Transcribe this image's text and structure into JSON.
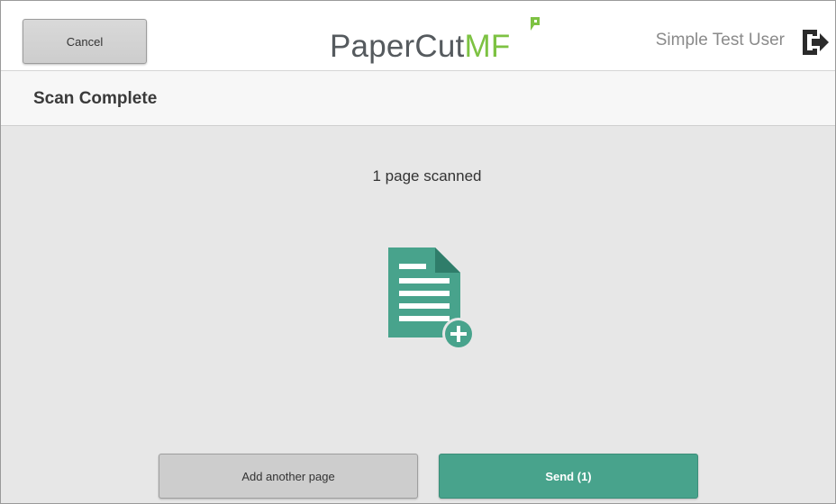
{
  "header": {
    "cancel_label": "Cancel",
    "logo": {
      "part1": "PaperCut",
      "part2": "MF"
    },
    "user_name": "Simple Test User",
    "logout_icon": "logout-icon"
  },
  "title_bar": {
    "title": "Scan Complete"
  },
  "main": {
    "status": "1 page scanned",
    "document_icon": "document-add-icon",
    "add_page_label": "Add another page",
    "send_label": "Send (1)"
  },
  "colors": {
    "accent": "#48a38c",
    "logo_green": "#7dc242",
    "logo_gray": "#555a5e",
    "content_bg": "#e7e7e7"
  }
}
